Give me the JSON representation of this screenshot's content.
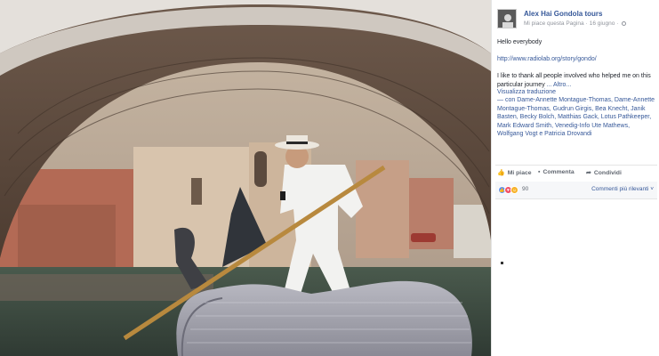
{
  "post": {
    "page_name": "Alex Hai Gondola tours",
    "like_page": "Mi piace questa Pagina",
    "date": "16 giugno",
    "greeting": "Hello everybody",
    "link": "http://www.radiolab.org/story/gondo/",
    "thanks_text": "I like to thank all people involved who helped me on this particular journey",
    "more": "... Altro...",
    "translate": "Visualizza traduzione",
    "tags_prefix": "— con",
    "tags": "Dame-Annette Montague-Thomas, Dame-Annette Montague-Thomas, Gudrun Girgis, Bea Knecht, Janik Basten, Becky Bolch, Matthias Gack, Lotus Pathkeeper, Mark Edward Smith, Venedig-Info Ute Mathews, Wolfgang Vogt e Patricia Drovandi"
  },
  "actions": {
    "like": "Mi piace",
    "comment": "Commenta",
    "share": "Condividi"
  },
  "reactions": {
    "count": "90",
    "sort": "Commenti più rilevanti ˅",
    "colors": {
      "like": "#5890ff",
      "love": "#f25268",
      "haha": "#f7b125"
    }
  },
  "icons": {
    "like": "thumbs-up-icon",
    "comment": "speech-bubble-icon",
    "share": "share-arrow-icon",
    "globe": "globe-icon"
  }
}
